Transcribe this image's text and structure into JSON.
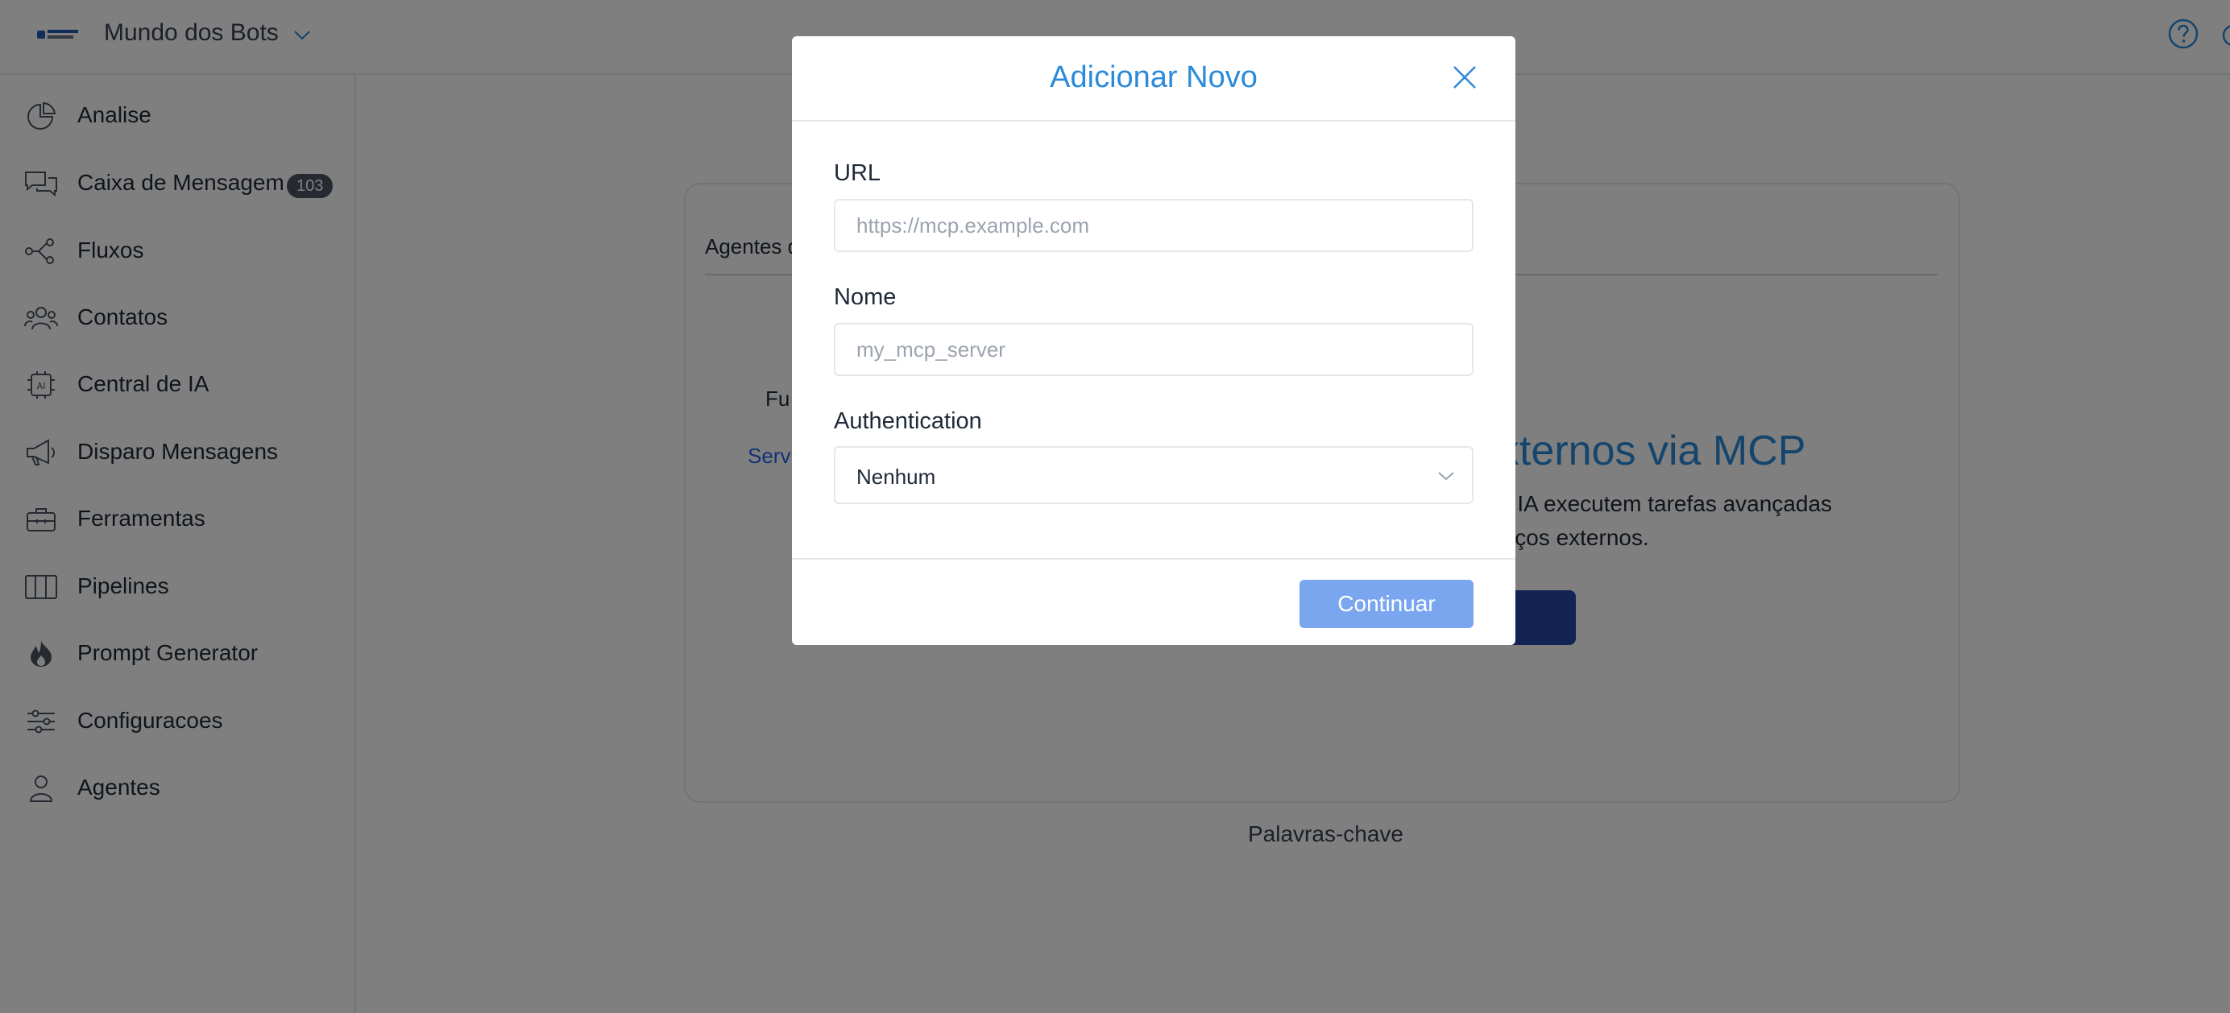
{
  "topbar": {
    "workspace_name": "Mundo dos Bots"
  },
  "sidebar": {
    "items": [
      {
        "label": "Analise",
        "icon": "pie-chart-icon"
      },
      {
        "label": "Caixa de Mensagem",
        "icon": "chat-bubbles-icon",
        "badge": "103"
      },
      {
        "label": "Fluxos",
        "icon": "flow-nodes-icon"
      },
      {
        "label": "Contatos",
        "icon": "people-icon"
      },
      {
        "label": "Central de IA",
        "icon": "ai-chip-icon"
      },
      {
        "label": "Disparo Mensagens",
        "icon": "megaphone-icon"
      },
      {
        "label": "Ferramentas",
        "icon": "toolbox-icon"
      },
      {
        "label": "Pipelines",
        "icon": "columns-icon"
      },
      {
        "label": "Prompt Generator",
        "icon": "flame-icon"
      },
      {
        "label": "Configuracoes",
        "icon": "sliders-icon"
      },
      {
        "label": "Agentes",
        "icon": "user-icon"
      }
    ]
  },
  "background": {
    "tab_label": "Agentes d",
    "label_a": "Fu",
    "label_b": "Servi",
    "heading_fragment": "xternos via MCP",
    "description_line1": "e IA executem tarefas avançadas",
    "description_line2": "viços externos.",
    "keywords": "Palavras-chave"
  },
  "modal": {
    "title": "Adicionar Novo",
    "url_label": "URL",
    "url_placeholder": "https://mcp.example.com",
    "url_value": "",
    "name_label": "Nome",
    "name_placeholder": "my_mcp_server",
    "name_value": "",
    "auth_label": "Authentication",
    "auth_value": "Nenhum",
    "continue_label": "Continuar"
  },
  "colors": {
    "accent": "#2b8ad9",
    "button_disabled": "#7aa6f0",
    "overlay": "rgba(0,0,0,0.5)",
    "badge": "#4b5563"
  }
}
